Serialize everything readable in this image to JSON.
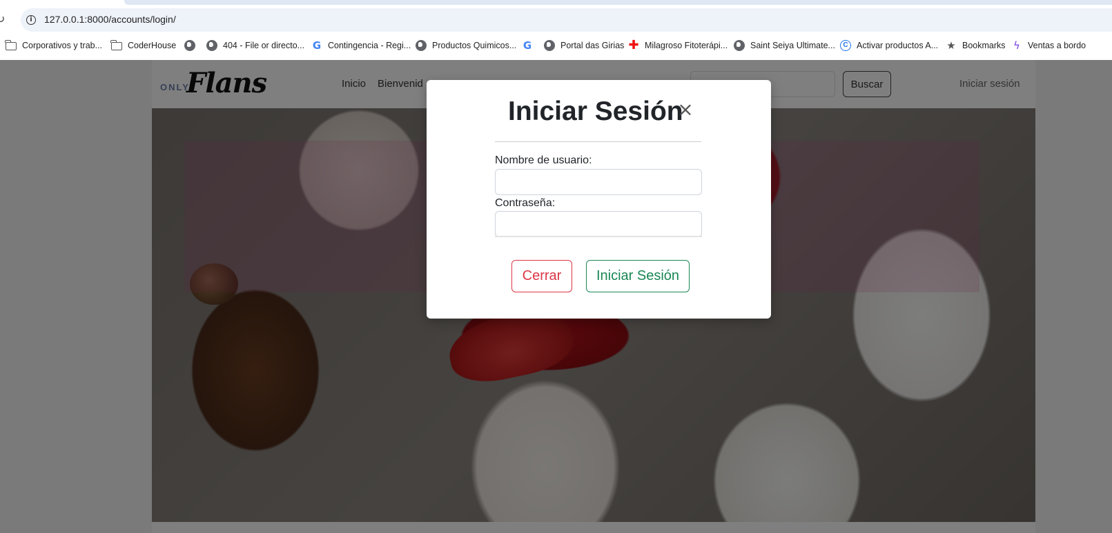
{
  "browser": {
    "url": "127.0.0.1:8000/accounts/login/",
    "bookmarks": [
      {
        "label": "Corporativos y trab...",
        "icon": "folder-icon"
      },
      {
        "label": "CoderHouse",
        "icon": "folder-icon"
      },
      {
        "label": "",
        "icon": "globe-icon"
      },
      {
        "label": "404 - File or directo...",
        "icon": "globe-icon"
      },
      {
        "label": "Contingencia - Regi...",
        "icon": "google-icon"
      },
      {
        "label": "Productos Quimicos...",
        "icon": "globe-icon"
      },
      {
        "label": "",
        "icon": "google-icon"
      },
      {
        "label": "Portal das Girias",
        "icon": "globe-icon"
      },
      {
        "label": "Milagroso Fitoterápi...",
        "icon": "red-cross-icon"
      },
      {
        "label": "Saint Seiya Ultimate...",
        "icon": "globe-icon"
      },
      {
        "label": "Activar productos A...",
        "icon": "c-badge-icon"
      },
      {
        "label": "Bookmarks",
        "icon": "star-icon"
      },
      {
        "label": "Ventas a bordo",
        "icon": "bolt-icon"
      }
    ]
  },
  "site": {
    "logo_small": "ONLY",
    "logo_main": "Flans",
    "nav": {
      "inicio": "Inicio",
      "bienvenida": "Bienvenid"
    },
    "search_button": "Buscar",
    "login_link": "Iniciar sesión"
  },
  "modal": {
    "title": "Iniciar Sesión",
    "close_glyph": "×",
    "username_label": "Nombre de usuario:",
    "username_value": "",
    "password_label": "Contraseña:",
    "password_value": "",
    "cancel_button": "Cerrar",
    "submit_button": "Iniciar Sesión"
  },
  "colors": {
    "danger": "#dc3545",
    "success": "#198754",
    "backdrop": "rgba(0,0,0,0.5)"
  }
}
